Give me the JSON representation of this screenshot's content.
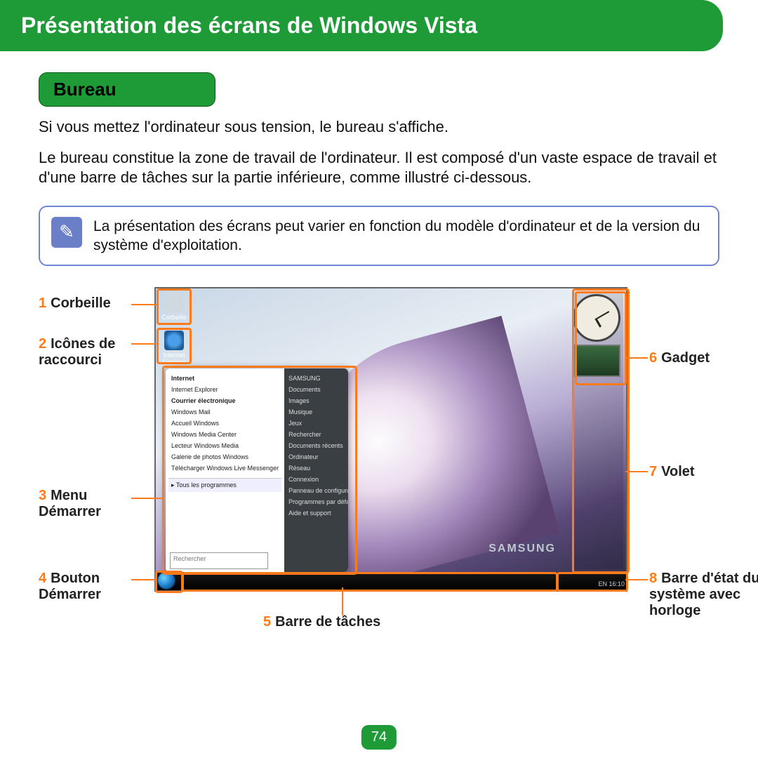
{
  "title": "Présentation des écrans de Windows Vista",
  "section": "Bureau",
  "intro1": "Si vous mettez l'ordinateur sous tension, le bureau s'affiche.",
  "intro2": "Le bureau constitue la zone de travail de l'ordinateur. Il est composé d'un vaste espace de travail et d'une barre de tâches sur la partie inférieure, comme illustré ci-dessous.",
  "note": "La présentation des écrans peut varier en fonction du modèle d'ordinateur et de la version du système d'exploitation.",
  "note_icon": "✎",
  "brand": "SAMSUNG",
  "tray_text": "EN  16:10",
  "recycle_label": "Corbeille",
  "ie_label": "Internet Explorer",
  "sm_left": {
    "internet": "Internet",
    "internet_sub": "Internet Explorer",
    "mail": "Courrier électronique",
    "mail_sub": "Windows Mail",
    "i1": "Accueil Windows",
    "i2": "Windows Media Center",
    "i3": "Lecteur Windows Media",
    "i4": "Galerie de photos Windows",
    "i5": "Télécharger Windows Live Messenger",
    "tous": "▸  Tous les programmes",
    "search": "Rechercher"
  },
  "sm_right": {
    "r0": "SAMSUNG",
    "r1": "Documents",
    "r2": "Images",
    "r3": "Musique",
    "r4": "Jeux",
    "r5": "Rechercher",
    "r6": "Documents récents",
    "r7": "Ordinateur",
    "r8": "Réseau",
    "r9": "Connexion",
    "r10": "Panneau de configuration",
    "r11": "Programmes par défaut",
    "r12": "Aide et support"
  },
  "callouts": {
    "c1": {
      "n": "1",
      "t": "Corbeille"
    },
    "c2": {
      "n": "2",
      "t": "Icônes de raccourci"
    },
    "c3": {
      "n": "3",
      "t": "Menu Démarrer"
    },
    "c4": {
      "n": "4",
      "t": "Bouton Démarrer"
    },
    "c5": {
      "n": "5",
      "t": "Barre de tâches"
    },
    "c6": {
      "n": "6",
      "t": "Gadget"
    },
    "c7": {
      "n": "7",
      "t": "Volet"
    },
    "c8": {
      "n": "8",
      "t": "Barre d'état du système avec horloge"
    }
  },
  "page_number": "74"
}
